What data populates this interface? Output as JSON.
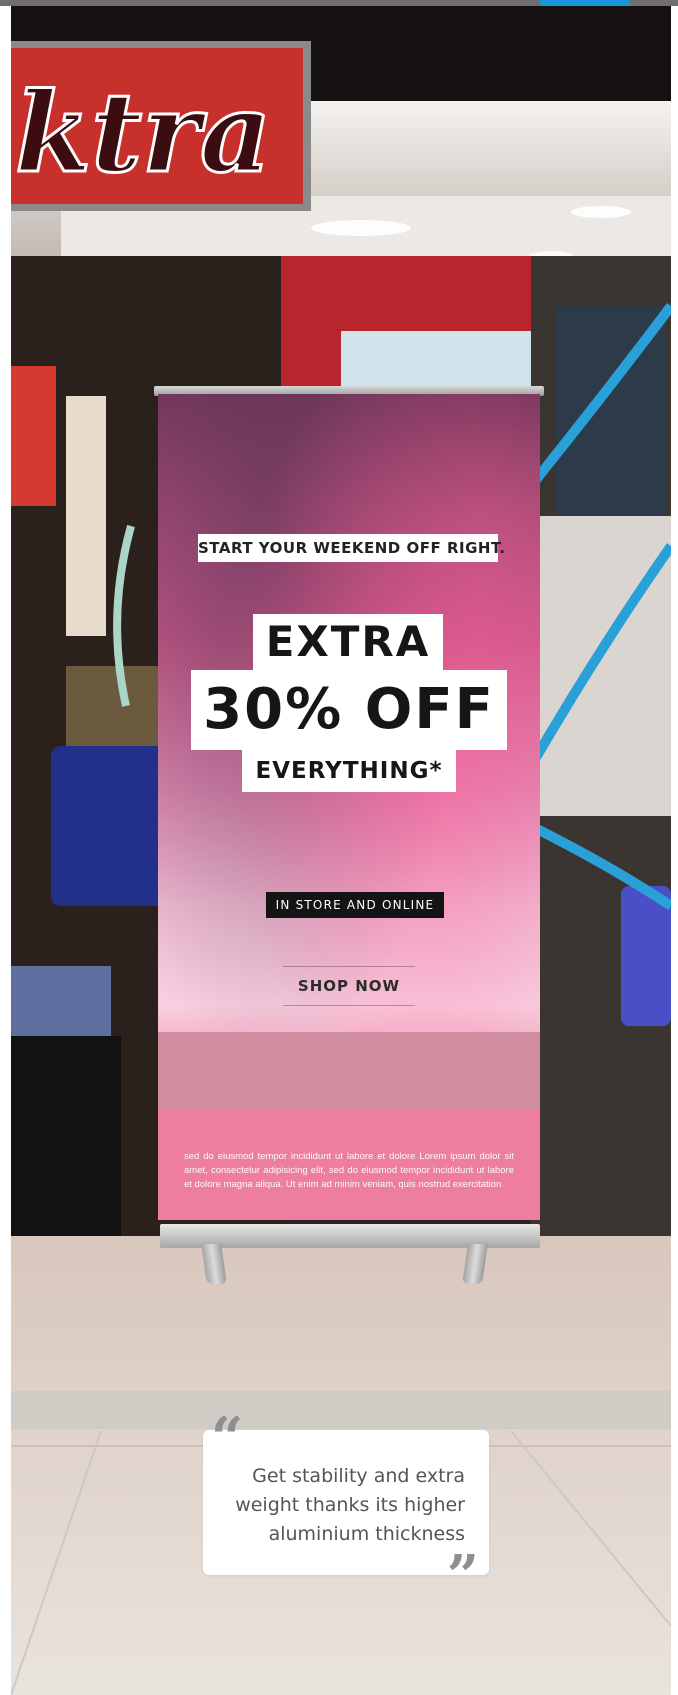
{
  "progress": {
    "fraction": 0.133
  },
  "store_sign": {
    "text": "ktra"
  },
  "banner": {
    "tagline": "START YOUR WEEKEND OFF RIGHT.",
    "headline_line1": "EXTRA",
    "headline_line2": "30% OFF",
    "headline_line3": "EVERYTHING*",
    "channel": "IN STORE AND ONLINE",
    "cta": "SHOP NOW",
    "fine_print": "sed do eiusmod tempor incididunt ut labore et dolore Lorem ipsum dolor sit amet, consectetur adipisicing elit, sed do eiusmod tempor incididunt ut labore et dolore magna aliqua. Ut enim ad minim veniam, quis nostrud exercitation"
  },
  "testimonial": {
    "open_mark": "“",
    "close_mark": "”",
    "text": "Get stability and extra weight thanks its higher aluminium thickness"
  },
  "colors": {
    "progress_accent": "#1798d6",
    "banner_pink": "#e07aa3",
    "sign_red": "#c8302c",
    "quote_mark_gray": "#8f8f8f"
  }
}
